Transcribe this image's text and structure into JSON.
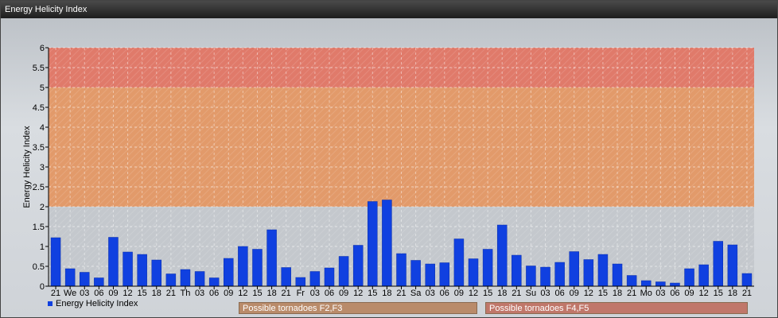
{
  "window": {
    "title": "Energy Helicity Index"
  },
  "chart_data": {
    "type": "bar",
    "ylabel": "Energy Helicity Index",
    "ylim": [
      0,
      6
    ],
    "yticks": [
      "0",
      "0.5",
      "1",
      "1.5",
      "2",
      "2.5",
      "3",
      "3.5",
      "4",
      "4.5",
      "5",
      "5.5",
      "6"
    ],
    "grid": true,
    "categories": [
      "21",
      "We",
      "03",
      "06",
      "09",
      "12",
      "15",
      "18",
      "21",
      "Th",
      "03",
      "06",
      "09",
      "12",
      "15",
      "18",
      "21",
      "Fr",
      "03",
      "06",
      "09",
      "12",
      "15",
      "18",
      "21",
      "Sa",
      "03",
      "06",
      "09",
      "12",
      "15",
      "18",
      "21",
      "Su",
      "03",
      "06",
      "09",
      "12",
      "15",
      "18",
      "21",
      "Mo",
      "03",
      "06",
      "09",
      "12",
      "15",
      "18",
      "21"
    ],
    "series": [
      {
        "name": "Energy Helicity Index",
        "color": "#1040e0",
        "values": [
          1.22,
          0.44,
          0.35,
          0.21,
          1.23,
          0.86,
          0.8,
          0.66,
          0.31,
          0.42,
          0.37,
          0.21,
          0.7,
          1.0,
          0.93,
          1.42,
          0.47,
          0.22,
          0.37,
          0.46,
          0.75,
          1.03,
          2.13,
          2.17,
          0.82,
          0.65,
          0.56,
          0.59,
          1.19,
          0.69,
          0.93,
          1.54,
          0.78,
          0.51,
          0.48,
          0.6,
          0.87,
          0.67,
          0.8,
          0.56,
          0.27,
          0.14,
          0.11,
          0.08,
          0.44,
          0.54,
          1.13,
          1.04,
          0.32
        ]
      }
    ],
    "bands": [
      {
        "from": 5,
        "to": 6,
        "color": "#e07a6a"
      },
      {
        "from": 2,
        "to": 5,
        "color": "#e29a6a"
      }
    ],
    "band_labels": [
      {
        "text": "Possible tornadoes F2,F3",
        "color": "#b98b6a"
      },
      {
        "text": "Possible tornadoes F4,F5",
        "color": "#c0776a"
      }
    ],
    "legend": {
      "label": "Energy Helicity Index",
      "position": "bottom-left"
    }
  }
}
